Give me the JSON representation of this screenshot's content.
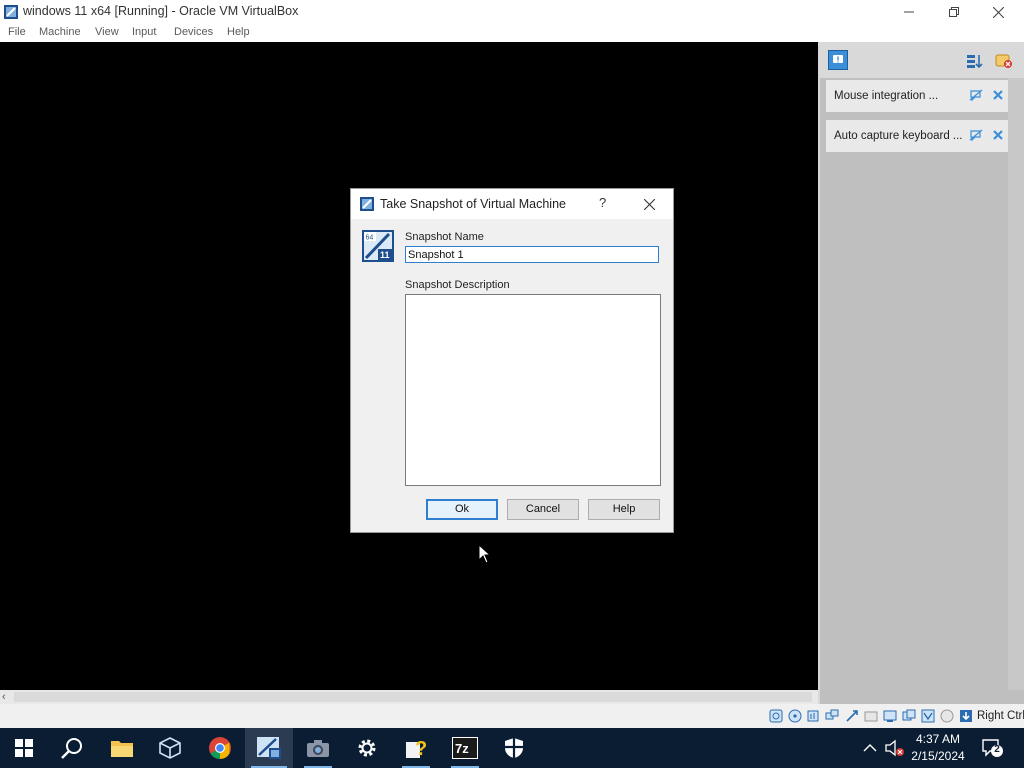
{
  "window": {
    "title": "windows 11 x64 [Running] - Oracle VM VirtualBox"
  },
  "menu": [
    "File",
    "Machine",
    "View",
    "Input",
    "Devices",
    "Help"
  ],
  "notifications": [
    {
      "text": "Mouse integration ..."
    },
    {
      "text": "Auto capture keyboard ..."
    }
  ],
  "statusbar": {
    "host_key": "Right Ctrl"
  },
  "dialog": {
    "title": "Take Snapshot of Virtual Machine",
    "help_glyph": "?",
    "os_badge_top": "64",
    "os_badge_bottom": "11",
    "name_label": "Snapshot Name",
    "name_value": "Snapshot 1",
    "desc_label": "Snapshot Description",
    "desc_value": "",
    "ok_label": "Ok",
    "cancel_label": "Cancel",
    "help_label": "Help"
  },
  "taskbar": {
    "apps": [
      "start",
      "search",
      "file-explorer",
      "virtualbox-cube",
      "chrome",
      "virtualbox-vm",
      "camera",
      "settings",
      "help",
      "7zip",
      "security"
    ],
    "clock_time": "4:37 AM",
    "clock_date": "2/15/2024",
    "notification_count": "2"
  },
  "colors": {
    "accent": "#2f7fd1",
    "taskbar": "#0b1d33",
    "vm_screen": "#000000"
  }
}
